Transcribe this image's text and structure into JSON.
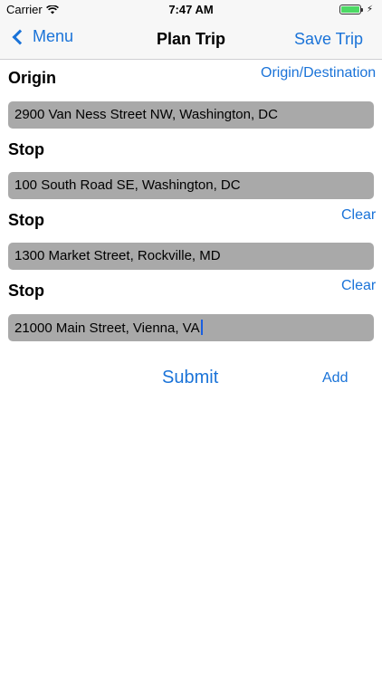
{
  "status_bar": {
    "carrier": "Carrier",
    "time": "7:47 AM",
    "wifi_icon": "wifi-icon",
    "battery_icon": "battery-icon",
    "battery_color": "#4cd964"
  },
  "nav": {
    "back_label": "Menu",
    "title": "Plan Trip",
    "right_label": "Save Trip"
  },
  "colors": {
    "accent": "#1a73d8",
    "field_bg": "#a9a9a9"
  },
  "origin": {
    "label": "Origin",
    "link": "Origin/Destination",
    "value": "2900 Van Ness Street NW, Washington, DC"
  },
  "stops": [
    {
      "label": "Stop",
      "value": "100 South Road SE, Washington, DC"
    },
    {
      "label": "Stop",
      "clear": "Clear",
      "value": "1300 Market Street, Rockville, MD"
    },
    {
      "label": "Stop",
      "clear": "Clear",
      "value": "21000 Main Street, Vienna, VA"
    }
  ],
  "actions": {
    "submit": "Submit",
    "add": "Add"
  }
}
